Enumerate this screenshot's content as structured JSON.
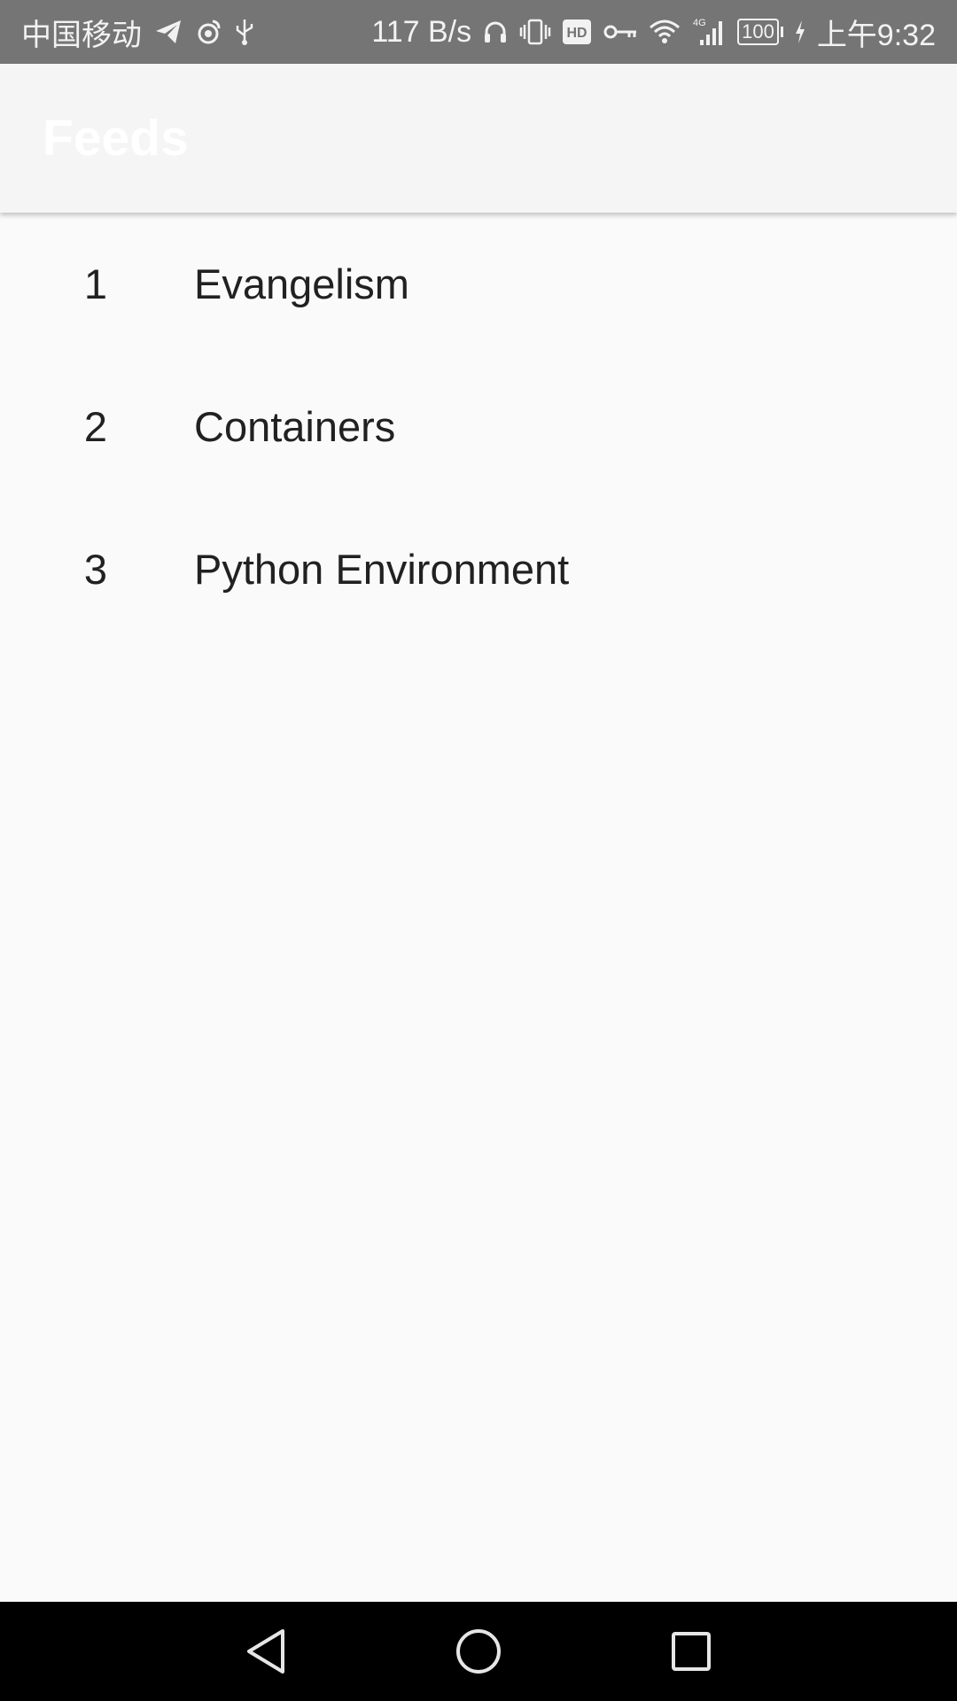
{
  "status_bar": {
    "carrier": "中国移动",
    "net_speed": "117 B/s",
    "network_type": "4G",
    "battery_level": "100",
    "time": "上午9:32",
    "left_icons": [
      "telegram-icon",
      "weibo-icon",
      "usb-icon"
    ],
    "right_icons": [
      "headphones-icon",
      "vibrate-icon",
      "hd-icon",
      "key-icon",
      "wifi-icon",
      "cell-signal-icon",
      "battery-icon",
      "charging-icon"
    ]
  },
  "app_bar": {
    "title": "Feeds",
    "background": "#f5f5f5",
    "title_color": "#ffffff"
  },
  "feeds": [
    {
      "index": "1",
      "title": "Evangelism"
    },
    {
      "index": "2",
      "title": "Containers"
    },
    {
      "index": "3",
      "title": "Python Environment"
    }
  ],
  "nav_bar": {
    "buttons": [
      "back-icon",
      "home-icon",
      "recents-icon"
    ]
  }
}
